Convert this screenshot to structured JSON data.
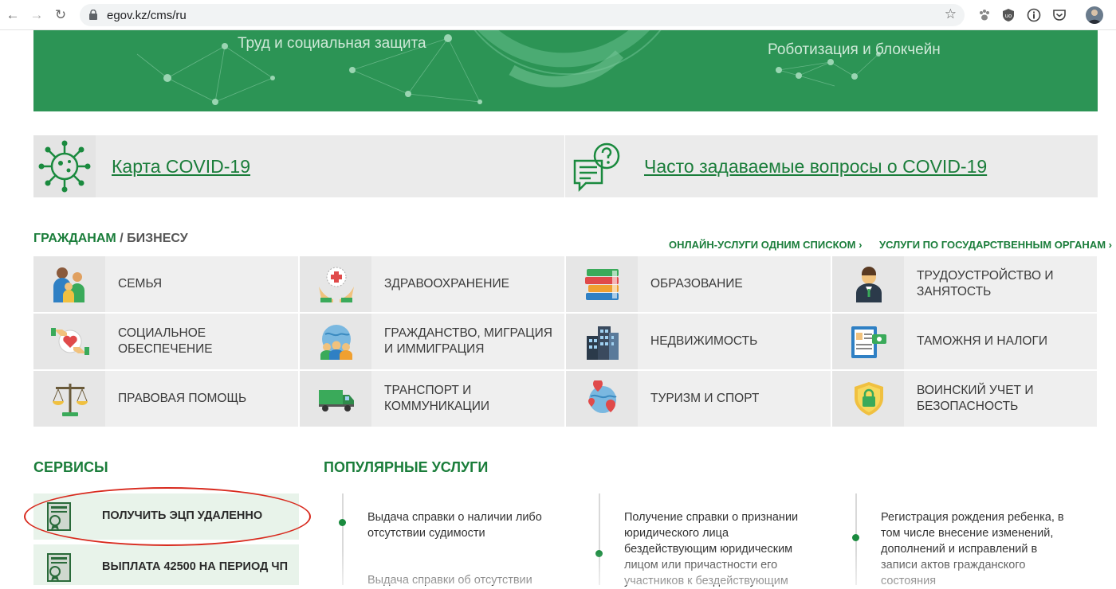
{
  "browser": {
    "url": "egov.kz/cms/ru",
    "back_icon": "arrow-left-icon",
    "forward_icon": "arrow-right-icon",
    "reload_icon": "reload-icon",
    "lock_icon": "lock-icon",
    "star_icon": "star-icon"
  },
  "banner": {
    "left_text": "Труд и социальная защита",
    "right_text": "Роботизация и блокчейн"
  },
  "covid": {
    "map_link": "Карта COVID-19",
    "faq_link": "Часто задаваемые вопросы о COVID-19"
  },
  "categories": {
    "tab_citizens": "ГРАЖДАНАМ",
    "separator": "/",
    "tab_business": "БИЗНЕСУ",
    "link_list": "ОНЛАЙН-УСЛУГИ ОДНИМ СПИСКОМ ›",
    "link_agencies": "УСЛУГИ ПО ГОСУДАРСТВЕННЫМ ОРГАНАМ ›",
    "items": [
      {
        "label": "СЕМЬЯ",
        "icon": "family-icon"
      },
      {
        "label": "ЗДРАВООХРАНЕНИЕ",
        "icon": "healthcare-icon"
      },
      {
        "label": "ОБРАЗОВАНИЕ",
        "icon": "books-icon"
      },
      {
        "label": "ТРУДОУСТРОЙСТВО И ЗАНЯТОСТЬ",
        "icon": "employee-icon"
      },
      {
        "label": "СОЦИАЛЬНОЕ ОБЕСПЕЧЕНИЕ",
        "icon": "social-care-icon"
      },
      {
        "label": "ГРАЖДАНСТВО, МИГРАЦИЯ И ИММИГРАЦИЯ",
        "icon": "globe-people-icon"
      },
      {
        "label": "НЕДВИЖИМОСТЬ",
        "icon": "buildings-icon"
      },
      {
        "label": "ТАМОЖНЯ И НАЛОГИ",
        "icon": "tax-document-icon"
      },
      {
        "label": "ПРАВОВАЯ ПОМОЩЬ",
        "icon": "scales-icon"
      },
      {
        "label": "ТРАНСПОРТ И КОММУНИКАЦИИ",
        "icon": "truck-icon"
      },
      {
        "label": "ТУРИЗМ И СПОРТ",
        "icon": "globe-pins-icon"
      },
      {
        "label": "ВОИНСКИЙ УЧЕТ И БЕЗОПАСНОСТЬ",
        "icon": "shield-lock-icon"
      }
    ]
  },
  "services": {
    "heading": "СЕРВИСЫ",
    "items": [
      {
        "label": "ПОЛУЧИТЬ ЭЦП УДАЛЕННО",
        "icon": "certificate-icon"
      },
      {
        "label": "ВЫПЛАТА 42500 НА ПЕРИОД ЧП",
        "icon": "certificate-icon"
      }
    ]
  },
  "popular": {
    "heading": "ПОПУЛЯРНЫЕ УСЛУГИ",
    "col1": [
      "Выдача справки о наличии либо отсутствии судимости",
      "Выдача справки об отсутствии"
    ],
    "col2": [
      "Получение справки о признании юридического лица бездействующим юридическим лицом или причастности его участников к бездействующим"
    ],
    "col3": [
      "Регистрация рождения ребенка, в том числе внесение изменений, дополнений и исправлений в записи актов гражданского состояния"
    ]
  },
  "colors": {
    "brand_green": "#1a7d3a",
    "banner_green": "#2c9455",
    "highlight_red": "#d82a1e"
  }
}
